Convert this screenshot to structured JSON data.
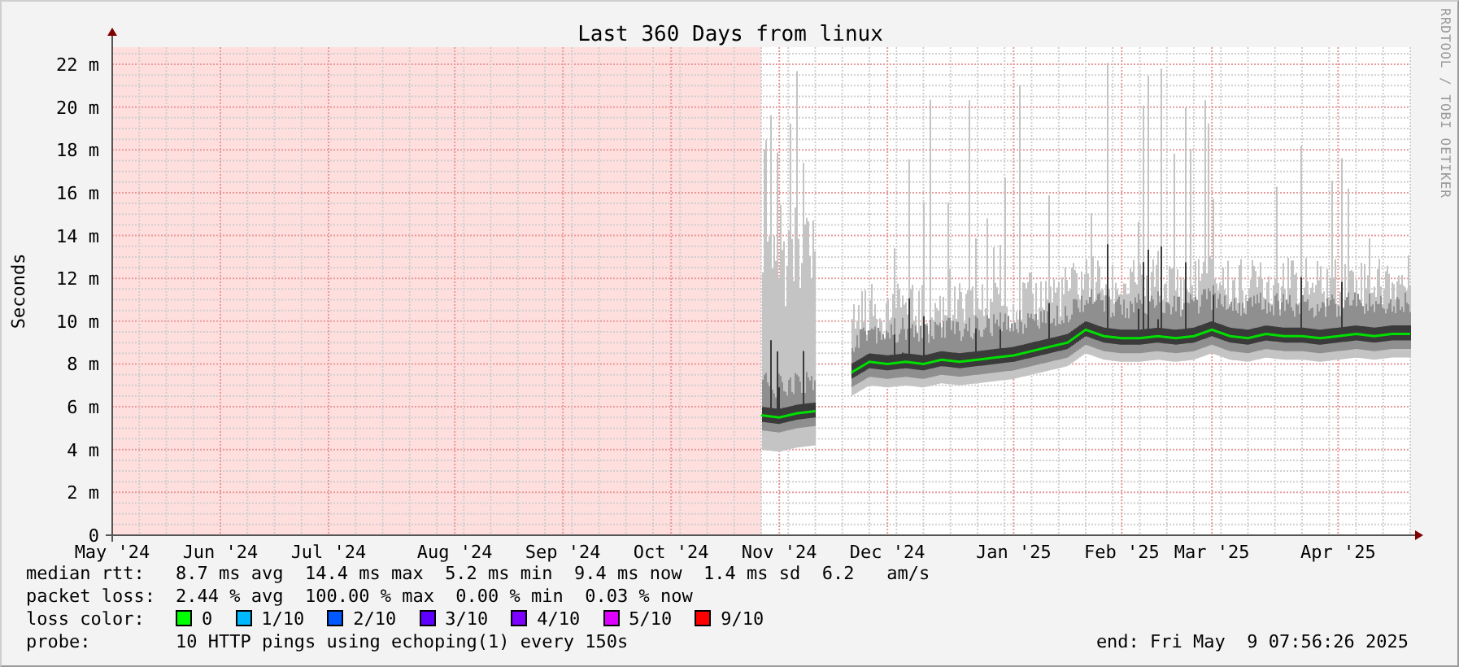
{
  "credit": "RRDTOOL / TOBI OETIKER",
  "chart_data": {
    "type": "line",
    "title": "Last 360 Days from linux",
    "ylabel": "Seconds",
    "grid": true,
    "categories": [
      "May '24",
      null,
      null,
      null,
      null,
      null,
      "Jun '24",
      null,
      null,
      null,
      null,
      null,
      "Jul '24",
      null,
      null,
      null,
      null,
      null,
      null,
      "Aug '24",
      null,
      null,
      null,
      null,
      null,
      "Sep '24",
      null,
      null,
      null,
      null,
      null,
      "Oct '24",
      null,
      null,
      null,
      null,
      null,
      "Nov '24",
      null,
      null,
      null,
      null,
      null,
      "Dec '24",
      null,
      null,
      null,
      null,
      null,
      null,
      "Jan '25",
      null,
      null,
      null,
      null,
      null,
      "Feb '25",
      null,
      null,
      null,
      null,
      "Mar '25",
      null,
      null,
      null,
      null,
      null,
      null,
      "Apr '25",
      null,
      null,
      null,
      null
    ],
    "ylim": [
      0,
      22.8
    ],
    "yticks": [
      {
        "value": 0,
        "label": "0"
      },
      {
        "value": 2,
        "label": "2 m"
      },
      {
        "value": 4,
        "label": "4 m"
      },
      {
        "value": 6,
        "label": "6 m"
      },
      {
        "value": 8,
        "label": "8 m"
      },
      {
        "value": 10,
        "label": "10 m"
      },
      {
        "value": 12,
        "label": "12 m"
      },
      {
        "value": 14,
        "label": "14 m"
      },
      {
        "value": 16,
        "label": "16 m"
      },
      {
        "value": 18,
        "label": "18 m"
      },
      {
        "value": 20,
        "label": "20 m"
      },
      {
        "value": 22,
        "label": "22 m"
      }
    ],
    "series": [
      {
        "color": "#00e000",
        "values": [
          null,
          null,
          null,
          null,
          null,
          null,
          null,
          null,
          null,
          null,
          null,
          null,
          null,
          null,
          null,
          null,
          null,
          null,
          null,
          null,
          null,
          null,
          null,
          null,
          null,
          null,
          null,
          null,
          null,
          null,
          null,
          null,
          null,
          null,
          null,
          null,
          5.6,
          5.5,
          5.7,
          5.8,
          null,
          7.6,
          8.1,
          8.0,
          8.1,
          8.0,
          8.2,
          8.1,
          8.2,
          8.3,
          8.4,
          8.6,
          8.8,
          9.0,
          9.6,
          9.3,
          9.2,
          9.2,
          9.3,
          9.2,
          9.3,
          9.6,
          9.3,
          9.2,
          9.4,
          9.3,
          9.3,
          9.2,
          9.3,
          9.4,
          9.3,
          9.4,
          9.4
        ]
      }
    ]
  },
  "stats": [
    {
      "label": "median rtt:",
      "text": "8.7 ms avg  14.4 ms max  5.2 ms min  9.4 ms now  1.4 ms sd  6.2   am/s"
    },
    {
      "label": "packet loss:",
      "text": "2.44 % avg  100.00 % max  0.00 % min  0.03 % now"
    }
  ],
  "loss_colors": {
    "label": "loss color:",
    "items": [
      {
        "label": "0",
        "color": "#00ff00"
      },
      {
        "label": "1/10",
        "color": "#00b8ff"
      },
      {
        "label": "2/10",
        "color": "#0059ff"
      },
      {
        "label": "3/10",
        "color": "#5e00ff"
      },
      {
        "label": "4/10",
        "color": "#7e00ff"
      },
      {
        "label": "5/10",
        "color": "#dd00ff"
      },
      {
        "label": "9/10",
        "color": "#ff0000"
      }
    ]
  },
  "probe": {
    "label": "probe:",
    "text": "10 HTTP pings using echoping(1) every 150s"
  },
  "end": "end: Fri May  9 07:56:26 2025"
}
